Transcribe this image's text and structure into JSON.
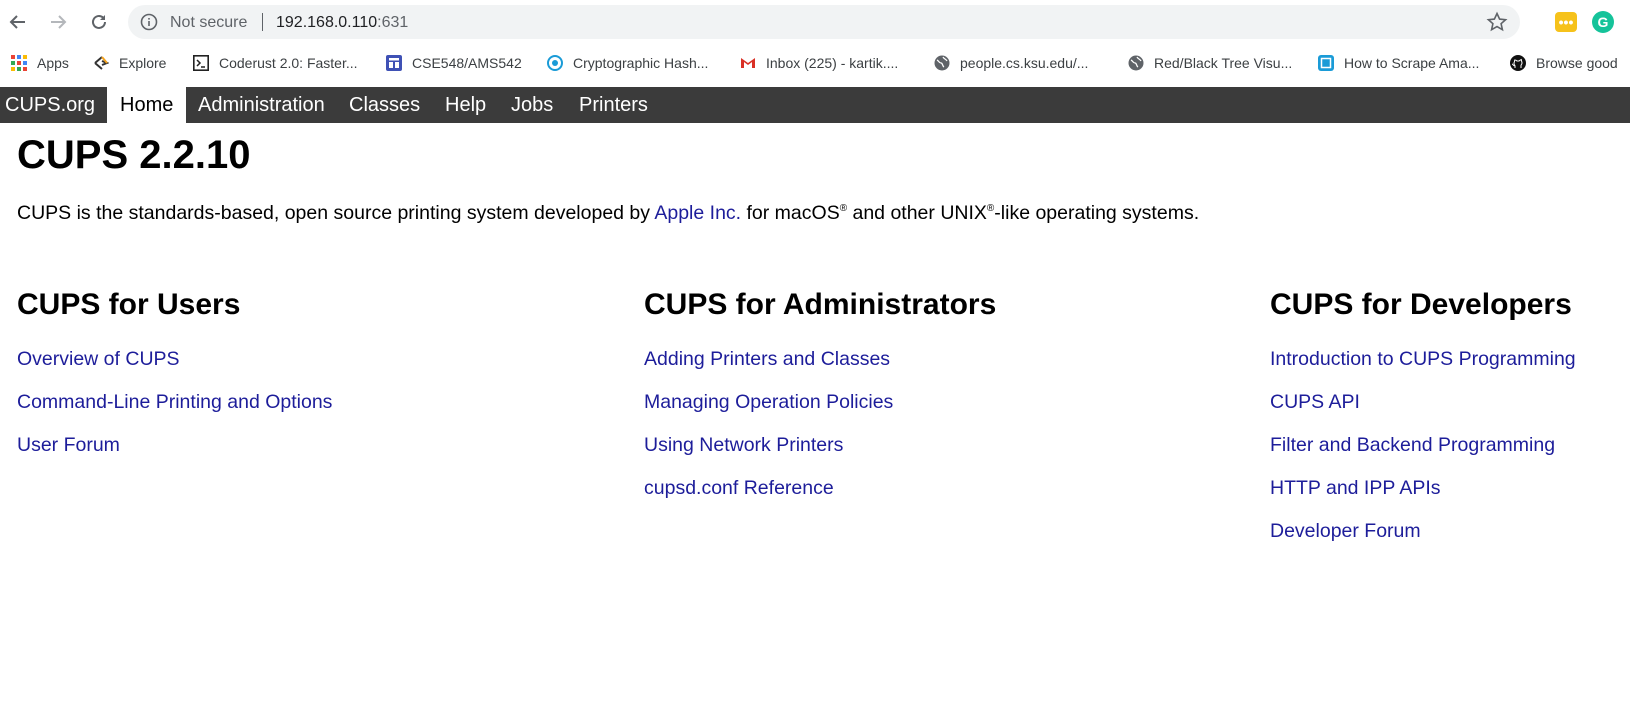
{
  "browser": {
    "address": {
      "security_label": "Not secure",
      "host": "192.168.0.110",
      "port": ":631"
    },
    "bookmarks": [
      {
        "label": "Apps",
        "icon": "apps-grid-icon"
      },
      {
        "label": "Explore",
        "icon": "explore-icon"
      },
      {
        "label": "Coderust 2.0: Faster...",
        "icon": "terminal-icon"
      },
      {
        "label": "CSE548/AMS542",
        "icon": "site-icon"
      },
      {
        "label": "Cryptographic Hash...",
        "icon": "site-icon"
      },
      {
        "label": "Inbox (225) - kartik....",
        "icon": "gmail-icon"
      },
      {
        "label": "people.cs.ksu.edu/...",
        "icon": "globe-icon"
      },
      {
        "label": "Red/Black Tree Visu...",
        "icon": "globe-icon"
      },
      {
        "label": "How to Scrape Ama...",
        "icon": "site-icon"
      },
      {
        "label": "Browse good",
        "icon": "github-icon"
      }
    ]
  },
  "cups_nav": {
    "items": [
      "CUPS.org",
      "Home",
      "Administration",
      "Classes",
      "Help",
      "Jobs",
      "Printers"
    ],
    "active": "Home"
  },
  "main": {
    "title": "CUPS 2.2.10",
    "intro": {
      "before": "CUPS is the standards-based, open source printing system developed by ",
      "link": "Apple Inc.",
      "after1": " for macOS",
      "reg1": "®",
      "after2": " and other UNIX",
      "reg2": "®",
      "after3": "-like operating systems."
    },
    "columns": [
      {
        "title": "CUPS for Users",
        "links": [
          "Overview of CUPS",
          "Command-Line Printing and Options",
          "User Forum"
        ]
      },
      {
        "title": "CUPS for Administrators",
        "links": [
          "Adding Printers and Classes",
          "Managing Operation Policies",
          "Using Network Printers",
          "cupsd.conf Reference"
        ]
      },
      {
        "title": "CUPS for Developers",
        "links": [
          "Introduction to CUPS Programming",
          "CUPS API",
          "Filter and Backend Programming",
          "HTTP and IPP APIs",
          "Developer Forum"
        ]
      }
    ]
  },
  "colors": {
    "nav_bar": "#3b3b3b",
    "link": "#1d1d9a",
    "omnibox": "#f1f3f4"
  }
}
